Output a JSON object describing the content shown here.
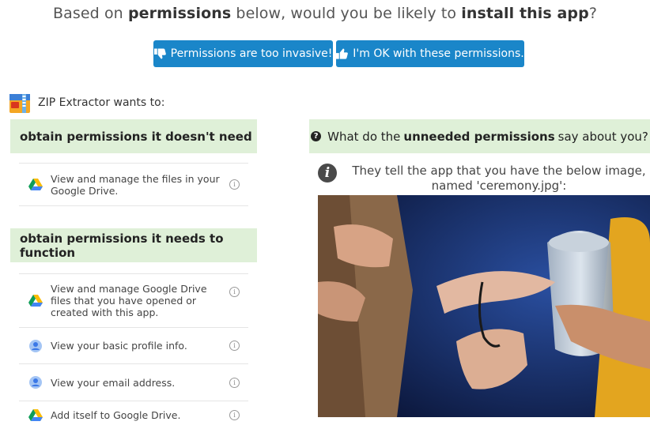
{
  "question": {
    "prefix": "Based on ",
    "bold1": "permissions",
    "middle": " below, would you be likely to ",
    "bold2": "install this app",
    "suffix": "?"
  },
  "buttons": {
    "decline": {
      "label": "Permissions are too invasive!",
      "icon": "thumbs-down-icon"
    },
    "accept": {
      "label": "I'm OK with these permissions.",
      "icon": "thumbs-up-icon"
    }
  },
  "app": {
    "name": "ZIP Extractor wants to:",
    "icon": "zip-archive-icon"
  },
  "sections": {
    "unneeded": {
      "title": "obtain permissions it doesn't need",
      "items": [
        {
          "label": "View and manage the files in your Google Drive.",
          "icon": "google-drive-icon"
        }
      ]
    },
    "needed": {
      "title": "obtain permissions it needs to function",
      "items": [
        {
          "label": "View and manage Google Drive files that you have opened or created with this app.",
          "icon": "google-drive-icon"
        },
        {
          "label": "View your basic profile info.",
          "icon": "person-icon"
        },
        {
          "label": "View your email address.",
          "icon": "person-icon"
        },
        {
          "label": "Add itself to Google Drive.",
          "icon": "google-drive-icon"
        }
      ]
    }
  },
  "info_glyph": "i",
  "right_panel": {
    "heading_prefix": "What do the ",
    "heading_bold": "unneeded permissions",
    "heading_suffix": " say about you?",
    "explanation": "They tell the app that you have the below image, named 'ceremony.jpg':"
  },
  "colors": {
    "button_blue": "#1a86c9",
    "section_green": "#dff0d8"
  }
}
